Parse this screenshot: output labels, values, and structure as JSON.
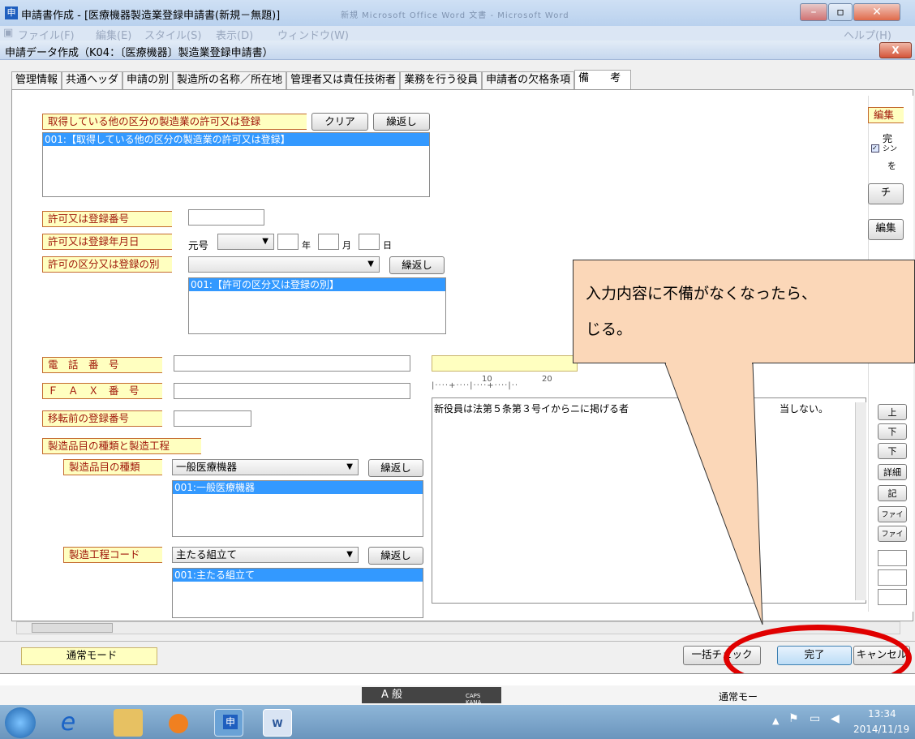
{
  "app": {
    "title": "申請書作成 - [医療機器製造業登録申請書(新規－無題)]",
    "icon_char": "申",
    "blurred_title": "新規 Microsoft Office Word 文書 - Microsoft Word"
  },
  "menu": {
    "items": [
      "ファイル(F)",
      "編集(E)",
      "スタイル(S)",
      "表示(D)",
      "ウィンドウ(W)"
    ],
    "help": "ヘルプ(H)"
  },
  "dialog": {
    "title": "申請データ作成（K04：〔医療機器〕製造業登録申請書）"
  },
  "tabs": [
    "管理情報",
    "共通ヘッダ",
    "申請の別",
    "製造所の名称／所在地",
    "管理者又は責任技術者",
    "業務を行う役員",
    "申請者の欠格条項",
    "備　　考"
  ],
  "other_license": {
    "label": "取得している他の区分の製造業の許可又は登録",
    "clear_button": "クリア",
    "repeat_button": "繰返し",
    "list": [
      "001:【取得している他の区分の製造業の許可又は登録】"
    ]
  },
  "license_number": {
    "label": "許可又は登録番号",
    "value": ""
  },
  "license_date": {
    "label": "許可又は登録年月日",
    "era_label": "元号",
    "year_label": "年",
    "month_label": "月",
    "day_label": "日"
  },
  "license_category": {
    "label": "許可の区分又は登録の別",
    "repeat_button": "繰返し",
    "list": [
      "001:【許可の区分又は登録の別】"
    ]
  },
  "phone": {
    "label": "電　話　番　号"
  },
  "fax": {
    "label": "Ｆ　Ａ　Ｘ　番　号"
  },
  "prior_reg": {
    "label": "移転前の登録番号"
  },
  "products_section": {
    "label": "製造品目の種類と製造工程"
  },
  "product_type": {
    "label": "製造品目の種類",
    "value": "一般医療機器",
    "repeat_button": "繰返し",
    "list": [
      "001:一般医療機器"
    ]
  },
  "process_code": {
    "label": "製造工程コード",
    "value": "主たる組立て",
    "repeat_button": "繰返し",
    "list": [
      "001:主たる組立て"
    ]
  },
  "remarks": {
    "ruler_10": "10",
    "ruler_20": "20",
    "text": "新役員は法第５条第３号イからニに掲げる者"
  },
  "remarks_text_tail": "当しない。",
  "right_panel": {
    "edit_label": "編集",
    "complete_text": "完",
    "check_button": "チ",
    "edit_button": "編集",
    "side_buttons": [
      "上",
      "下",
      "下",
      "詳細",
      "記",
      "ファイ",
      "ファイ"
    ],
    "checkbox_text": "シン",
    "wo": "を"
  },
  "callout": {
    "line1": "入力内容に不備がなくなったら、",
    "line2": "じる。"
  },
  "bottom": {
    "mode_label": "通常モード",
    "bulk_check_button": "一括チェック",
    "complete_button": "完了",
    "cancel_button": "キャンセル"
  },
  "status": {
    "ime": "A 般",
    "mode": "通常モー",
    "caps": "CAPS",
    "kana": "KANA"
  },
  "taskbar": {
    "time": "13:34",
    "date": "2014/11/19",
    "app_char": "申"
  },
  "colors": {
    "label_bg": "#ffffc0",
    "label_text": "#a0180a",
    "selection": "#3399ff",
    "callout_bg": "#fbd7b8",
    "highlight_ring": "#e00000"
  }
}
